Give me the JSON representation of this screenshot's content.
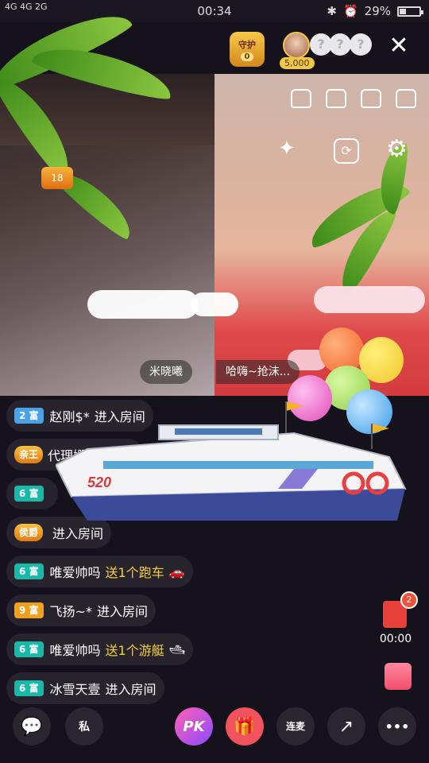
{
  "status_bar": {
    "network_left": "4G 4G 2G",
    "time": "00:34",
    "battery": "29%",
    "battery_level": 0.29
  },
  "top": {
    "guard_label": "守护",
    "guard_count": "0",
    "coins": "5,000",
    "seat_placeholder": "?"
  },
  "video": {
    "left_name": "米晓曦",
    "right_name": "哈嗨~抢沫...",
    "left_level": "18"
  },
  "chat": [
    {
      "rank": "2",
      "rank_label": "富",
      "rank_color": "blue",
      "name": "赵刚$*",
      "action": "进入房间"
    },
    {
      "badge": "亲王",
      "name": "代理姗儿或者...",
      "action": ""
    },
    {
      "rank": "6",
      "rank_label": "富",
      "rank_color": "teal",
      "name": "",
      "action": ""
    },
    {
      "badge": "侯爵",
      "name": "",
      "action": "进入房间"
    },
    {
      "rank": "6",
      "rank_label": "富",
      "rank_color": "teal",
      "name": "唯爱帅吗",
      "gift": "送1个跑车",
      "gift_icon": "🚗"
    },
    {
      "rank": "9",
      "rank_label": "富",
      "rank_color": "orange",
      "name": "飞扬~*",
      "action": "进入房间"
    },
    {
      "rank": "6",
      "rank_label": "富",
      "rank_color": "teal",
      "name": "唯爱帅吗",
      "gift": "送1个游艇",
      "gift_icon": "🛥"
    },
    {
      "rank": "6",
      "rank_label": "富",
      "rank_color": "teal",
      "name": "冰雪天壹",
      "action": "进入房间"
    }
  ],
  "yacht_label": "520",
  "red_packet": {
    "badge": "2",
    "time": "00:00"
  },
  "bottom": {
    "comment_icon": "chat-bubble-icon",
    "private_label": "私",
    "pk_label": "PK",
    "gift_icon": "gift-icon",
    "lianmai_label": "连麦",
    "share_icon": "share-icon",
    "more_label": "•••"
  }
}
